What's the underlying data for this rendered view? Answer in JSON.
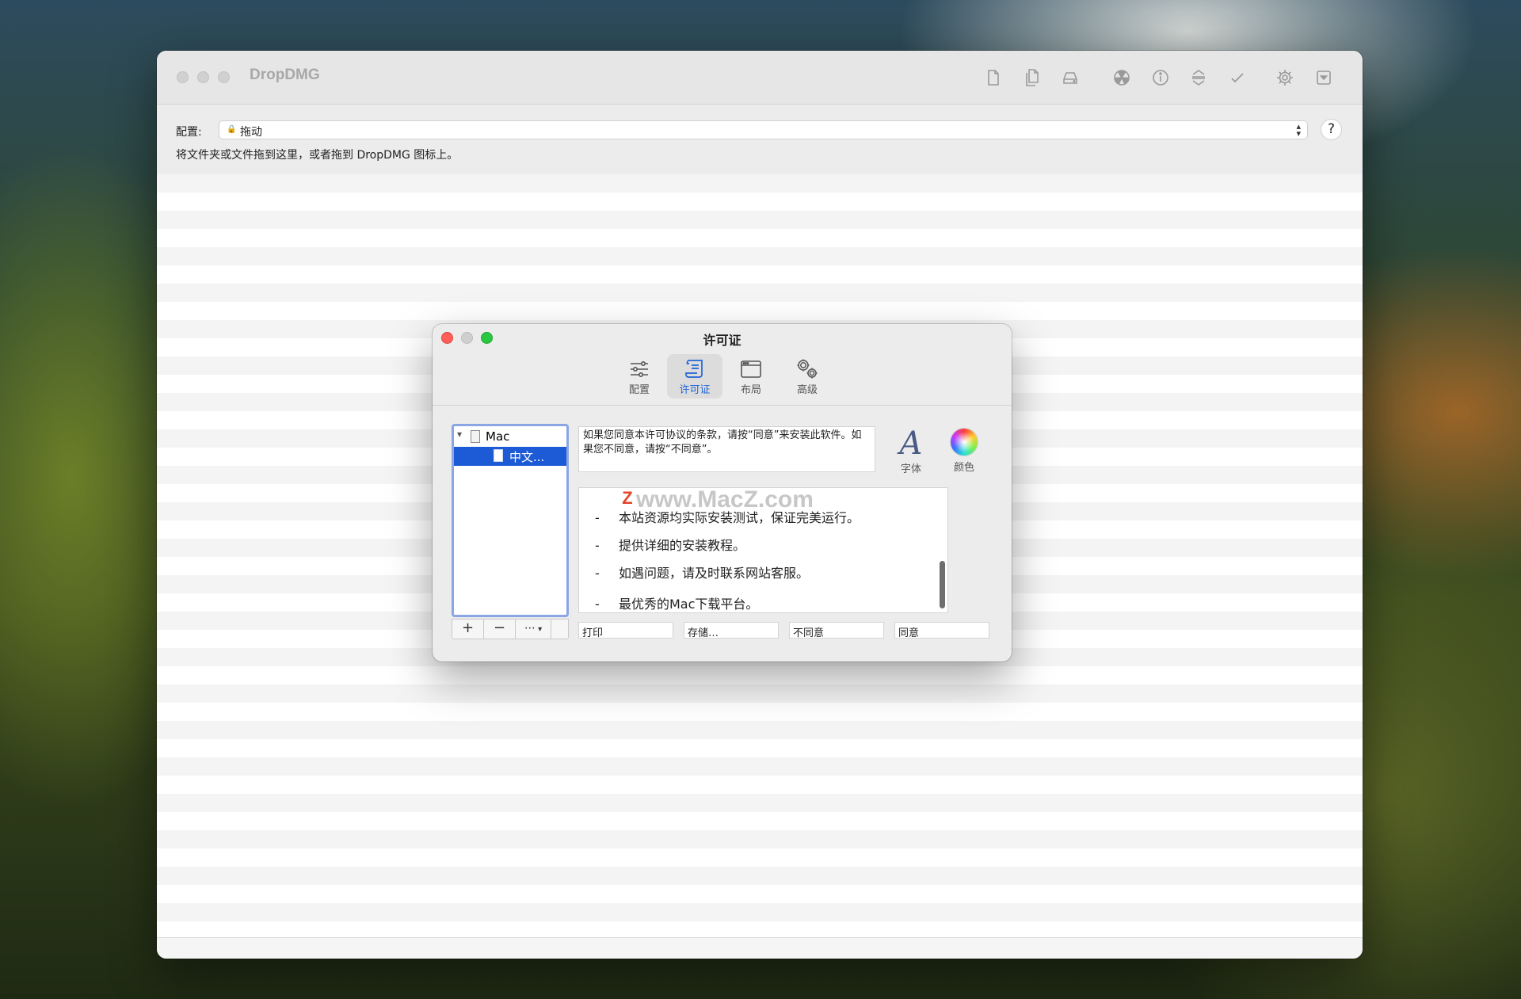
{
  "main": {
    "app_title": "DropDMG",
    "toolbar_icons": [
      "new-file-icon",
      "copy-file-icon",
      "drive-icon",
      "radiation-icon",
      "info-icon",
      "compress-icon",
      "checkmark-icon",
      "settings-icon",
      "dropdown-icon"
    ],
    "config_label": "配置:",
    "config_value": "拖动",
    "help_label": "?",
    "hint": "将文件夹或文件拖到这里，或者拖到 DropDMG 图标上。"
  },
  "dialog": {
    "title": "许可证",
    "tabs": [
      {
        "label": "配置",
        "icon": "sliders-icon",
        "active": false
      },
      {
        "label": "许可证",
        "icon": "license-scroll-icon",
        "active": true
      },
      {
        "label": "布局",
        "icon": "window-layout-icon",
        "active": false
      },
      {
        "label": "高级",
        "icon": "advanced-gears-icon",
        "active": false
      }
    ],
    "tree": {
      "root": "Mac",
      "child": "中文..."
    },
    "tree_buttons": {
      "add": "+",
      "remove": "−",
      "more": "⋯"
    },
    "prompt": "如果您同意本许可协议的条款，请按“同意”来安装此软件。如果您不同意，请按“不同意”。",
    "font_label": "字体",
    "color_label": "颜色",
    "license_lines": [
      "本站资源均实际安装测试，保证完美运行。",
      "提供详细的安装教程。",
      "如遇问题，请及时联系网站客服。",
      "最优秀的Mac下载平台。"
    ],
    "watermark": "www.MacZ.com",
    "watermark_logo": "Z",
    "bullet_mark": "-",
    "dash_line": "———————————————————————————————————",
    "fields": {
      "print": "打印",
      "save": "存储…",
      "disagree": "不同意",
      "agree": "同意"
    }
  },
  "colors": {
    "accent": "#1d5bd6",
    "close": "#ff5f57",
    "minimize": "#c8c8c8",
    "zoom": "#28c840"
  }
}
